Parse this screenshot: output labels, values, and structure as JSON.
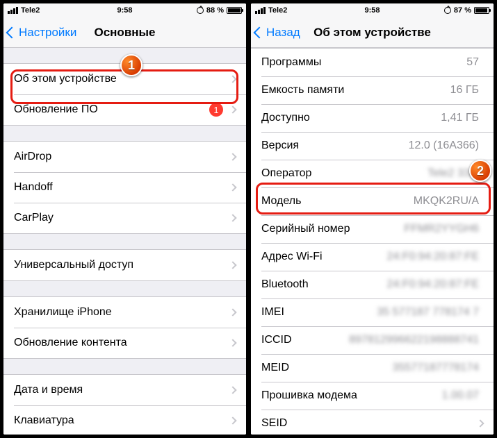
{
  "status": {
    "carrier": "Tele2",
    "time": "9:58",
    "left_battery_pct": "88 %",
    "right_battery_pct": "87 %",
    "left_fill": "88%",
    "right_fill": "87%"
  },
  "left": {
    "back": "Настройки",
    "title": "Основные",
    "groups": [
      {
        "rows": [
          {
            "label": "Об этом устройстве",
            "chev": true
          },
          {
            "label": "Обновление ПО",
            "chev": true,
            "badge": "1"
          }
        ]
      },
      {
        "rows": [
          {
            "label": "AirDrop",
            "chev": true
          },
          {
            "label": "Handoff",
            "chev": true
          },
          {
            "label": "CarPlay",
            "chev": true
          }
        ]
      },
      {
        "rows": [
          {
            "label": "Универсальный доступ",
            "chev": true
          }
        ]
      },
      {
        "rows": [
          {
            "label": "Хранилище iPhone",
            "chev": true
          },
          {
            "label": "Обновление контента",
            "chev": true
          }
        ]
      },
      {
        "rows": [
          {
            "label": "Дата и время",
            "chev": true
          },
          {
            "label": "Клавиатура",
            "chev": true
          }
        ]
      }
    ]
  },
  "right": {
    "back": "Назад",
    "title": "Об этом устройстве",
    "rows": [
      {
        "label": "Программы",
        "value": "57"
      },
      {
        "label": "Емкость памяти",
        "value": "16 ГБ"
      },
      {
        "label": "Доступно",
        "value": "1,41 ГБ"
      },
      {
        "label": "Версия",
        "value": "12.0 (16A366)"
      },
      {
        "label": "Оператор",
        "value": "Tele2 33.0",
        "blur": true
      },
      {
        "label": "Модель",
        "value": "MKQK2RU/A"
      },
      {
        "label": "Серийный номер",
        "value": "FFMR2YYGH6",
        "blur": true
      },
      {
        "label": "Адрес Wi-Fi",
        "value": "24:F0:94:20:87:FE",
        "blur": true
      },
      {
        "label": "Bluetooth",
        "value": "24:F0:94:20:87:FE",
        "blur": true
      },
      {
        "label": "IMEI",
        "value": "35 577187 778174 7",
        "blur": true
      },
      {
        "label": "ICCID",
        "value": "897812996622198888741",
        "blur": true
      },
      {
        "label": "MEID",
        "value": "35577187778174",
        "blur": true
      },
      {
        "label": "Прошивка модема",
        "value": "1.00.07",
        "blur": true
      },
      {
        "label": "SEID",
        "value": "",
        "chev": true
      }
    ]
  },
  "callouts": {
    "one": "1",
    "two": "2"
  }
}
